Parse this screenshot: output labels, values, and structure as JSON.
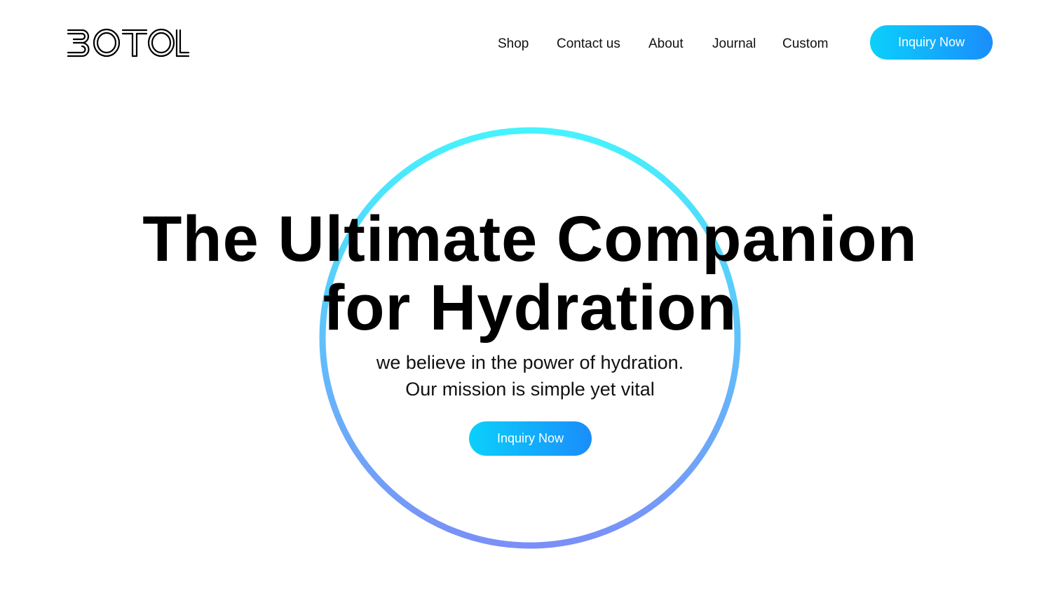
{
  "brand": {
    "logo_text": "BOTOL"
  },
  "nav": {
    "items": [
      {
        "label": "Shop"
      },
      {
        "label": "Contact us"
      },
      {
        "label": "About"
      },
      {
        "label": "Journal"
      },
      {
        "label": "Custom"
      }
    ]
  },
  "header": {
    "cta_label": "Inquiry Now"
  },
  "hero": {
    "title_line1": "The Ultimate Companion",
    "title_line2": "for Hydration",
    "subtitle_line1": "we believe in the power of hydration.",
    "subtitle_line2": "Our mission is simple yet vital",
    "cta_label": "Inquiry Now",
    "ring_icon": "gradient-circle"
  },
  "colors": {
    "button_start": "#0bd0fb",
    "button_end": "#1a8dfb",
    "ring_top": "#45f3fd",
    "ring_bottom": "#7a8ff7",
    "text": "#000000",
    "background": "#ffffff"
  }
}
